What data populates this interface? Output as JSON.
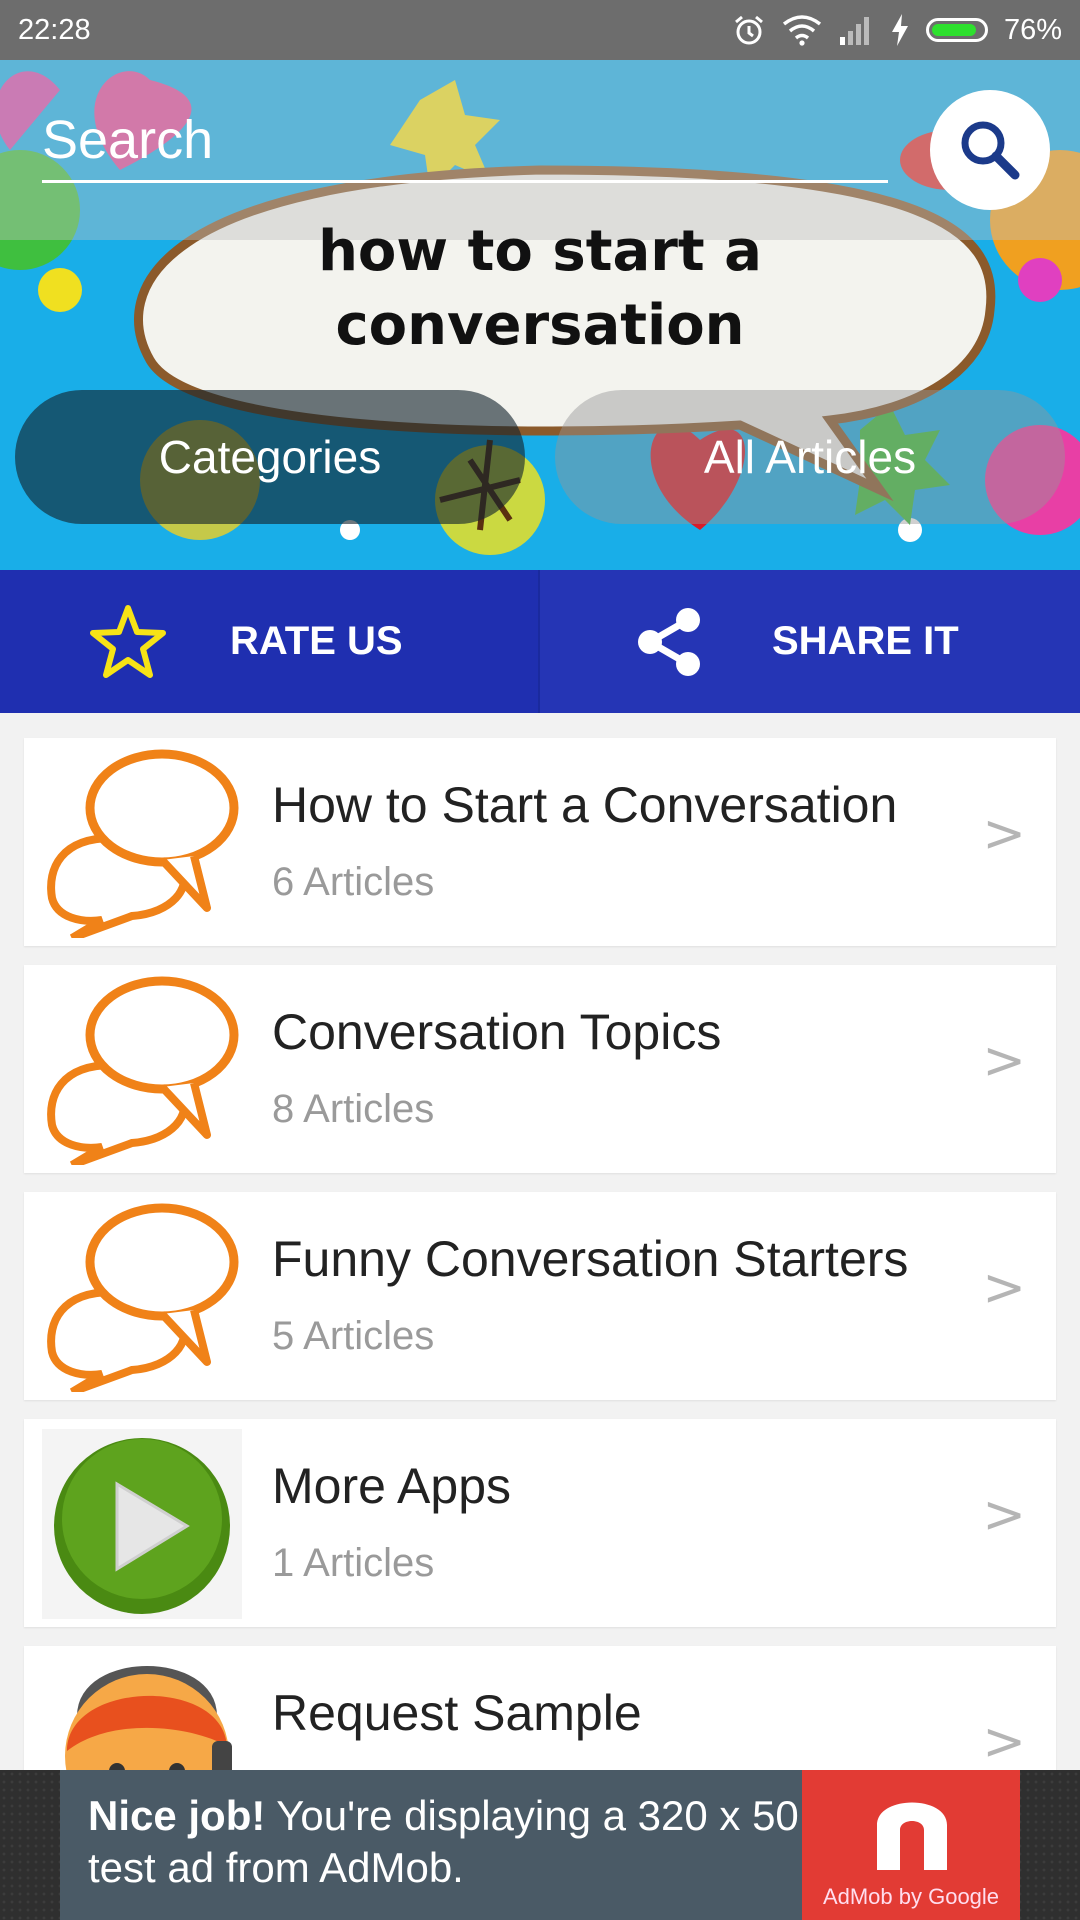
{
  "status_bar": {
    "time": "22:28",
    "battery": "76%"
  },
  "search": {
    "placeholder": "Search"
  },
  "banner": {
    "title_line1": "how to start a",
    "title_line2": "conversation"
  },
  "nav": {
    "categories": "Categories",
    "all_articles": "All Articles"
  },
  "actions": {
    "rate": "RATE US",
    "share": "SHARE IT"
  },
  "list": [
    {
      "title": "How to Start a Conversation",
      "count": "6 Articles",
      "icon": "speech-bubbles-icon"
    },
    {
      "title": "Conversation Topics",
      "count": "8 Articles",
      "icon": "speech-bubbles-icon"
    },
    {
      "title": "Funny Conversation Starters",
      "count": "5 Articles",
      "icon": "speech-bubbles-icon"
    },
    {
      "title": "More Apps",
      "count": "1 Articles",
      "icon": "play-icon"
    },
    {
      "title": "Request Sample",
      "count": "",
      "icon": "support-agent-icon"
    }
  ],
  "chevron": ">",
  "ad": {
    "bold": "Nice job!",
    "text": " You're displaying a 320 x 50 test ad from AdMob.",
    "brand": "AdMob by Google"
  },
  "colors": {
    "status_bar": "#6d6d6d",
    "banner_bg": "#19aee8",
    "action_bar": "#1f2fb0",
    "bubble_orange": "#f08218",
    "play_green": "#4a8a12",
    "ad_red": "#e23b34"
  }
}
